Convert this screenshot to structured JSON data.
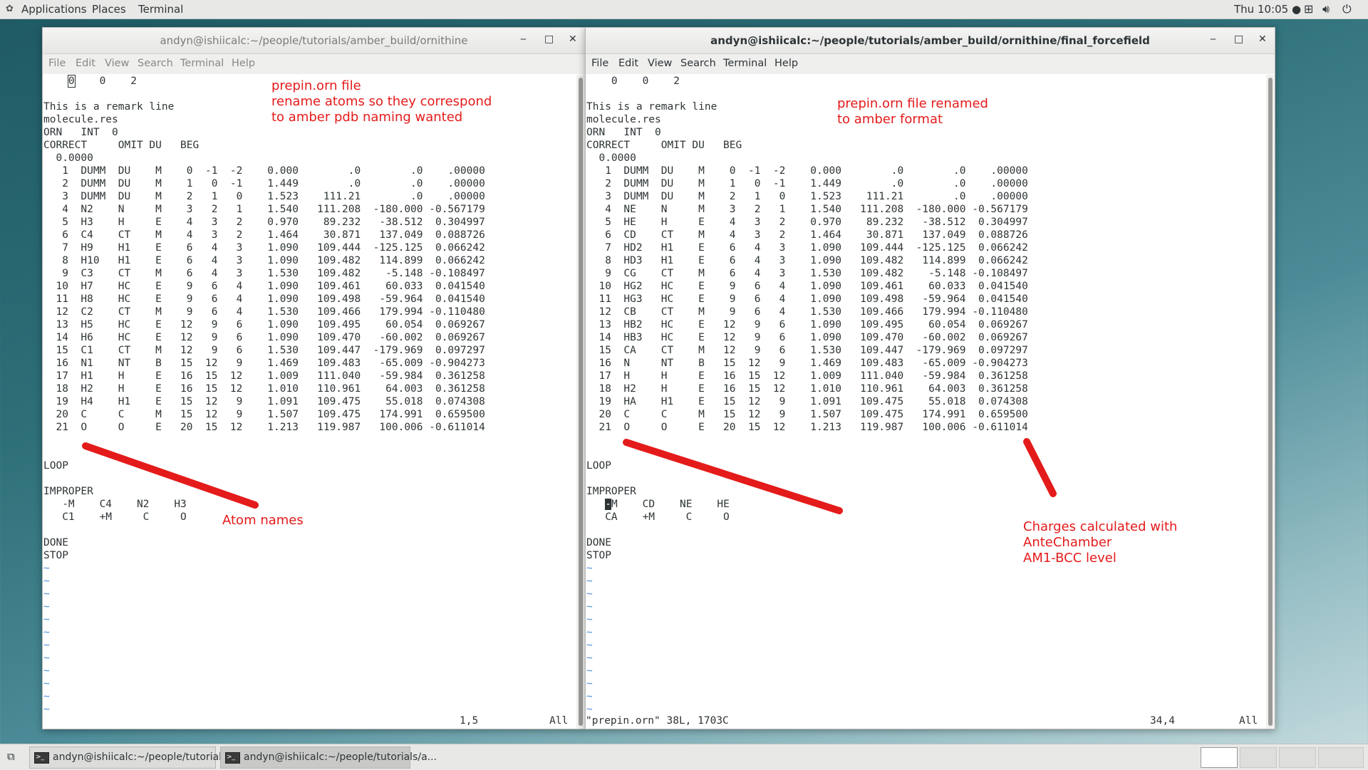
{
  "topbar": {
    "applications": "Applications",
    "places": "Places",
    "terminal": "Terminal",
    "clock": "Thu 10:05 ●",
    "icons": [
      "network-icon",
      "volume-icon",
      "power-icon"
    ]
  },
  "window_left": {
    "title": "andyn@ishiicalc:~/people/tutorials/amber_build/ornithine",
    "menu": [
      "File",
      "Edit",
      "View",
      "Search",
      "Terminal",
      "Help"
    ],
    "cursor_pos": "1,5",
    "scroll": "All",
    "annotations": {
      "a1": "prepin.orn file\nrename atoms so they correspond\nto amber pdb naming wanted",
      "a2": "Atom names"
    }
  },
  "window_right": {
    "title": "andyn@ishiicalc:~/people/tutorials/amber_build/ornithine/final_forcefield",
    "menu": [
      "File",
      "Edit",
      "View",
      "Search",
      "Terminal",
      "Help"
    ],
    "file_info": "\"prepin.orn\" 38L, 1703C",
    "cursor_pos": "34,4",
    "scroll": "All",
    "annotations": {
      "a1": "prepin.orn file renamed\nto amber format",
      "a2": "Charges calculated with\nAnteChamber\nAM1-BCC level"
    }
  },
  "header_lines": [
    "",
    "This is a remark line",
    "molecule.res",
    "ORN   INT  0",
    "CORRECT     OMIT DU   BEG",
    "  0.0000"
  ],
  "first_line": {
    "cursor_char": "0",
    "rest": "    0    2",
    "plain": "    0    0    2"
  },
  "atoms_left": [
    [
      "1",
      "DUMM",
      "DU",
      "M",
      "0",
      "-1",
      "-2",
      "0.000",
      ".0",
      ".0",
      ".00000"
    ],
    [
      "2",
      "DUMM",
      "DU",
      "M",
      "1",
      "0",
      "-1",
      "1.449",
      ".0",
      ".0",
      ".00000"
    ],
    [
      "3",
      "DUMM",
      "DU",
      "M",
      "2",
      "1",
      "0",
      "1.523",
      "111.21",
      ".0",
      ".00000"
    ],
    [
      "4",
      "N2",
      "N",
      "M",
      "3",
      "2",
      "1",
      "1.540",
      "111.208",
      "-180.000",
      "-0.567179"
    ],
    [
      "5",
      "H3",
      "H",
      "E",
      "4",
      "3",
      "2",
      "0.970",
      "89.232",
      "-38.512",
      "0.304997"
    ],
    [
      "6",
      "C4",
      "CT",
      "M",
      "4",
      "3",
      "2",
      "1.464",
      "30.871",
      "137.049",
      "0.088726"
    ],
    [
      "7",
      "H9",
      "H1",
      "E",
      "6",
      "4",
      "3",
      "1.090",
      "109.444",
      "-125.125",
      "0.066242"
    ],
    [
      "8",
      "H10",
      "H1",
      "E",
      "6",
      "4",
      "3",
      "1.090",
      "109.482",
      "114.899",
      "0.066242"
    ],
    [
      "9",
      "C3",
      "CT",
      "M",
      "6",
      "4",
      "3",
      "1.530",
      "109.482",
      "-5.148",
      "-0.108497"
    ],
    [
      "10",
      "H7",
      "HC",
      "E",
      "9",
      "6",
      "4",
      "1.090",
      "109.461",
      "60.033",
      "0.041540"
    ],
    [
      "11",
      "H8",
      "HC",
      "E",
      "9",
      "6",
      "4",
      "1.090",
      "109.498",
      "-59.964",
      "0.041540"
    ],
    [
      "12",
      "C2",
      "CT",
      "M",
      "9",
      "6",
      "4",
      "1.530",
      "109.466",
      "179.994",
      "-0.110480"
    ],
    [
      "13",
      "H5",
      "HC",
      "E",
      "12",
      "9",
      "6",
      "1.090",
      "109.495",
      "60.054",
      "0.069267"
    ],
    [
      "14",
      "H6",
      "HC",
      "E",
      "12",
      "9",
      "6",
      "1.090",
      "109.470",
      "-60.002",
      "0.069267"
    ],
    [
      "15",
      "C1",
      "CT",
      "M",
      "12",
      "9",
      "6",
      "1.530",
      "109.447",
      "-179.969",
      "0.097297"
    ],
    [
      "16",
      "N1",
      "NT",
      "B",
      "15",
      "12",
      "9",
      "1.469",
      "109.483",
      "-65.009",
      "-0.904273"
    ],
    [
      "17",
      "H1",
      "H",
      "E",
      "16",
      "15",
      "12",
      "1.009",
      "111.040",
      "-59.984",
      "0.361258"
    ],
    [
      "18",
      "H2",
      "H",
      "E",
      "16",
      "15",
      "12",
      "1.010",
      "110.961",
      "64.003",
      "0.361258"
    ],
    [
      "19",
      "H4",
      "H1",
      "E",
      "15",
      "12",
      "9",
      "1.091",
      "109.475",
      "55.018",
      "0.074308"
    ],
    [
      "20",
      "C",
      "C",
      "M",
      "15",
      "12",
      "9",
      "1.507",
      "109.475",
      "174.991",
      "0.659500"
    ],
    [
      "21",
      "O",
      "O",
      "E",
      "20",
      "15",
      "12",
      "1.213",
      "119.987",
      "100.006",
      "-0.611014"
    ]
  ],
  "atoms_right": [
    [
      "1",
      "DUMM",
      "DU",
      "M",
      "0",
      "-1",
      "-2",
      "0.000",
      ".0",
      ".0",
      ".00000"
    ],
    [
      "2",
      "DUMM",
      "DU",
      "M",
      "1",
      "0",
      "-1",
      "1.449",
      ".0",
      ".0",
      ".00000"
    ],
    [
      "3",
      "DUMM",
      "DU",
      "M",
      "2",
      "1",
      "0",
      "1.523",
      "111.21",
      ".0",
      ".00000"
    ],
    [
      "4",
      "NE",
      "N",
      "M",
      "3",
      "2",
      "1",
      "1.540",
      "111.208",
      "-180.000",
      "-0.567179"
    ],
    [
      "5",
      "HE",
      "H",
      "E",
      "4",
      "3",
      "2",
      "0.970",
      "89.232",
      "-38.512",
      "0.304997"
    ],
    [
      "6",
      "CD",
      "CT",
      "M",
      "4",
      "3",
      "2",
      "1.464",
      "30.871",
      "137.049",
      "0.088726"
    ],
    [
      "7",
      "HD2",
      "H1",
      "E",
      "6",
      "4",
      "3",
      "1.090",
      "109.444",
      "-125.125",
      "0.066242"
    ],
    [
      "8",
      "HD3",
      "H1",
      "E",
      "6",
      "4",
      "3",
      "1.090",
      "109.482",
      "114.899",
      "0.066242"
    ],
    [
      "9",
      "CG",
      "CT",
      "M",
      "6",
      "4",
      "3",
      "1.530",
      "109.482",
      "-5.148",
      "-0.108497"
    ],
    [
      "10",
      "HG2",
      "HC",
      "E",
      "9",
      "6",
      "4",
      "1.090",
      "109.461",
      "60.033",
      "0.041540"
    ],
    [
      "11",
      "HG3",
      "HC",
      "E",
      "9",
      "6",
      "4",
      "1.090",
      "109.498",
      "-59.964",
      "0.041540"
    ],
    [
      "12",
      "CB",
      "CT",
      "M",
      "9",
      "6",
      "4",
      "1.530",
      "109.466",
      "179.994",
      "-0.110480"
    ],
    [
      "13",
      "HB2",
      "HC",
      "E",
      "12",
      "9",
      "6",
      "1.090",
      "109.495",
      "60.054",
      "0.069267"
    ],
    [
      "14",
      "HB3",
      "HC",
      "E",
      "12",
      "9",
      "6",
      "1.090",
      "109.470",
      "-60.002",
      "0.069267"
    ],
    [
      "15",
      "CA",
      "CT",
      "M",
      "12",
      "9",
      "6",
      "1.530",
      "109.447",
      "-179.969",
      "0.097297"
    ],
    [
      "16",
      "N",
      "NT",
      "B",
      "15",
      "12",
      "9",
      "1.469",
      "109.483",
      "-65.009",
      "-0.904273"
    ],
    [
      "17",
      "H",
      "H",
      "E",
      "16",
      "15",
      "12",
      "1.009",
      "111.040",
      "-59.984",
      "0.361258"
    ],
    [
      "18",
      "H2",
      "H",
      "E",
      "16",
      "15",
      "12",
      "1.010",
      "110.961",
      "64.003",
      "0.361258"
    ],
    [
      "19",
      "HA",
      "H1",
      "E",
      "15",
      "12",
      "9",
      "1.091",
      "109.475",
      "55.018",
      "0.074308"
    ],
    [
      "20",
      "C",
      "C",
      "M",
      "15",
      "12",
      "9",
      "1.507",
      "109.475",
      "174.991",
      "0.659500"
    ],
    [
      "21",
      "O",
      "O",
      "E",
      "20",
      "15",
      "12",
      "1.213",
      "119.987",
      "100.006",
      "-0.611014"
    ]
  ],
  "footer_left": {
    "loop": "LOOP",
    "improper": "IMPROPER",
    "imp1": "   -M    C4    N2    H3",
    "imp2": "   C1    +M     C     O",
    "done": "DONE",
    "stop": "STOP"
  },
  "footer_right": {
    "loop": "LOOP",
    "improper": "IMPROPER",
    "imp1_cursor": "-",
    "imp1_rest": "M    CD    NE    HE",
    "imp2": "   CA    +M     C     O",
    "done": "DONE",
    "stop": "STOP"
  },
  "taskbar": {
    "task1": "andyn@ishiicalc:~/people/tutorials/a...",
    "task2": "andyn@ishiicalc:~/people/tutorials/a..."
  },
  "colors": {
    "annotation": "#e41b1b",
    "tilde": "#4a90d9"
  }
}
